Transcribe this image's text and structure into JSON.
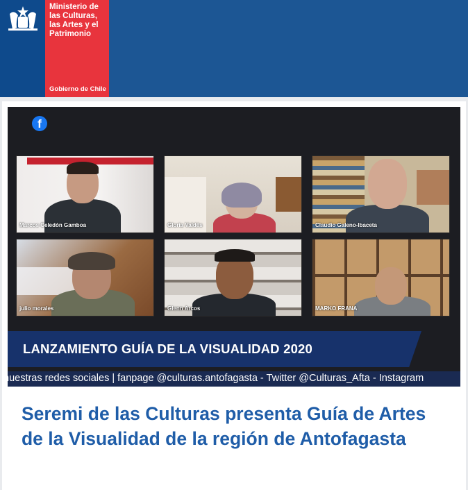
{
  "header": {
    "ministry_name": "Ministerio de las Culturas, las Artes y el Patrimonio",
    "government": "Gobierno de Chile",
    "colors": {
      "bar": "#1c5694",
      "logo_blue": "#0e4a8c",
      "logo_red": "#e8343d"
    }
  },
  "video": {
    "facebook_icon": "facebook-icon",
    "participants": [
      {
        "name": "Marcos Celedón Gamboa"
      },
      {
        "name": "Gloria Valdés"
      },
      {
        "name": "Claudio Galeno-Ibaceta"
      },
      {
        "name": "julio morales"
      },
      {
        "name": "Glenn Arcos"
      },
      {
        "name": "MARKO FRANA"
      }
    ],
    "banner_title": "LANZAMIENTO GUÍA DE LA VISUALIDAD 2020",
    "ticker": "nuestras redes sociales | fanpage @culturas.antofagasta - Twitter @Culturas_Afta - Instagram"
  },
  "article": {
    "title": "Seremi de las Culturas presenta Guía de Artes de la Visualidad de la región de Antofagasta"
  }
}
